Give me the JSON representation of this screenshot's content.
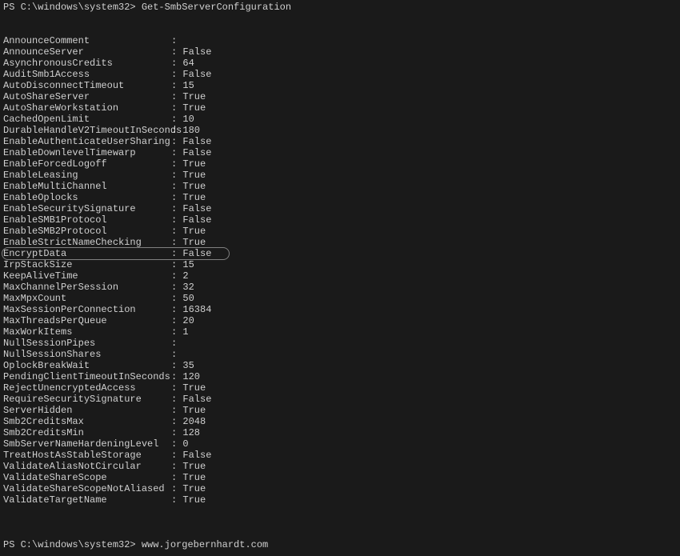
{
  "prompt1": {
    "prompt": "PS C:\\windows\\system32> ",
    "command": "Get-SmbServerConfiguration"
  },
  "output": [
    {
      "key": "AnnounceComment",
      "value": ""
    },
    {
      "key": "AnnounceServer",
      "value": "False"
    },
    {
      "key": "AsynchronousCredits",
      "value": "64"
    },
    {
      "key": "AuditSmb1Access",
      "value": "False"
    },
    {
      "key": "AutoDisconnectTimeout",
      "value": "15"
    },
    {
      "key": "AutoShareServer",
      "value": "True"
    },
    {
      "key": "AutoShareWorkstation",
      "value": "True"
    },
    {
      "key": "CachedOpenLimit",
      "value": "10"
    },
    {
      "key": "DurableHandleV2TimeoutInSeconds",
      "value": "180"
    },
    {
      "key": "EnableAuthenticateUserSharing",
      "value": "False"
    },
    {
      "key": "EnableDownlevelTimewarp",
      "value": "False"
    },
    {
      "key": "EnableForcedLogoff",
      "value": "True"
    },
    {
      "key": "EnableLeasing",
      "value": "True"
    },
    {
      "key": "EnableMultiChannel",
      "value": "True"
    },
    {
      "key": "EnableOplocks",
      "value": "True"
    },
    {
      "key": "EnableSecuritySignature",
      "value": "False"
    },
    {
      "key": "EnableSMB1Protocol",
      "value": "False"
    },
    {
      "key": "EnableSMB2Protocol",
      "value": "True"
    },
    {
      "key": "EnableStrictNameChecking",
      "value": "True"
    },
    {
      "key": "EncryptData",
      "value": "False",
      "highlight": true
    },
    {
      "key": "IrpStackSize",
      "value": "15"
    },
    {
      "key": "KeepAliveTime",
      "value": "2"
    },
    {
      "key": "MaxChannelPerSession",
      "value": "32"
    },
    {
      "key": "MaxMpxCount",
      "value": "50"
    },
    {
      "key": "MaxSessionPerConnection",
      "value": "16384"
    },
    {
      "key": "MaxThreadsPerQueue",
      "value": "20"
    },
    {
      "key": "MaxWorkItems",
      "value": "1"
    },
    {
      "key": "NullSessionPipes",
      "value": ""
    },
    {
      "key": "NullSessionShares",
      "value": ""
    },
    {
      "key": "OplockBreakWait",
      "value": "35"
    },
    {
      "key": "PendingClientTimeoutInSeconds",
      "value": "120"
    },
    {
      "key": "RejectUnencryptedAccess",
      "value": "True"
    },
    {
      "key": "RequireSecuritySignature",
      "value": "False"
    },
    {
      "key": "ServerHidden",
      "value": "True"
    },
    {
      "key": "Smb2CreditsMax",
      "value": "2048"
    },
    {
      "key": "Smb2CreditsMin",
      "value": "128"
    },
    {
      "key": "SmbServerNameHardeningLevel",
      "value": "0"
    },
    {
      "key": "TreatHostAsStableStorage",
      "value": "False"
    },
    {
      "key": "ValidateAliasNotCircular",
      "value": "True"
    },
    {
      "key": "ValidateShareScope",
      "value": "True"
    },
    {
      "key": "ValidateShareScopeNotAliased",
      "value": "True"
    },
    {
      "key": "ValidateTargetName",
      "value": "True"
    }
  ],
  "prompt2": {
    "prompt": "PS C:\\windows\\system32> ",
    "command": "www.jorgebernhardt.com"
  },
  "separator": ": "
}
